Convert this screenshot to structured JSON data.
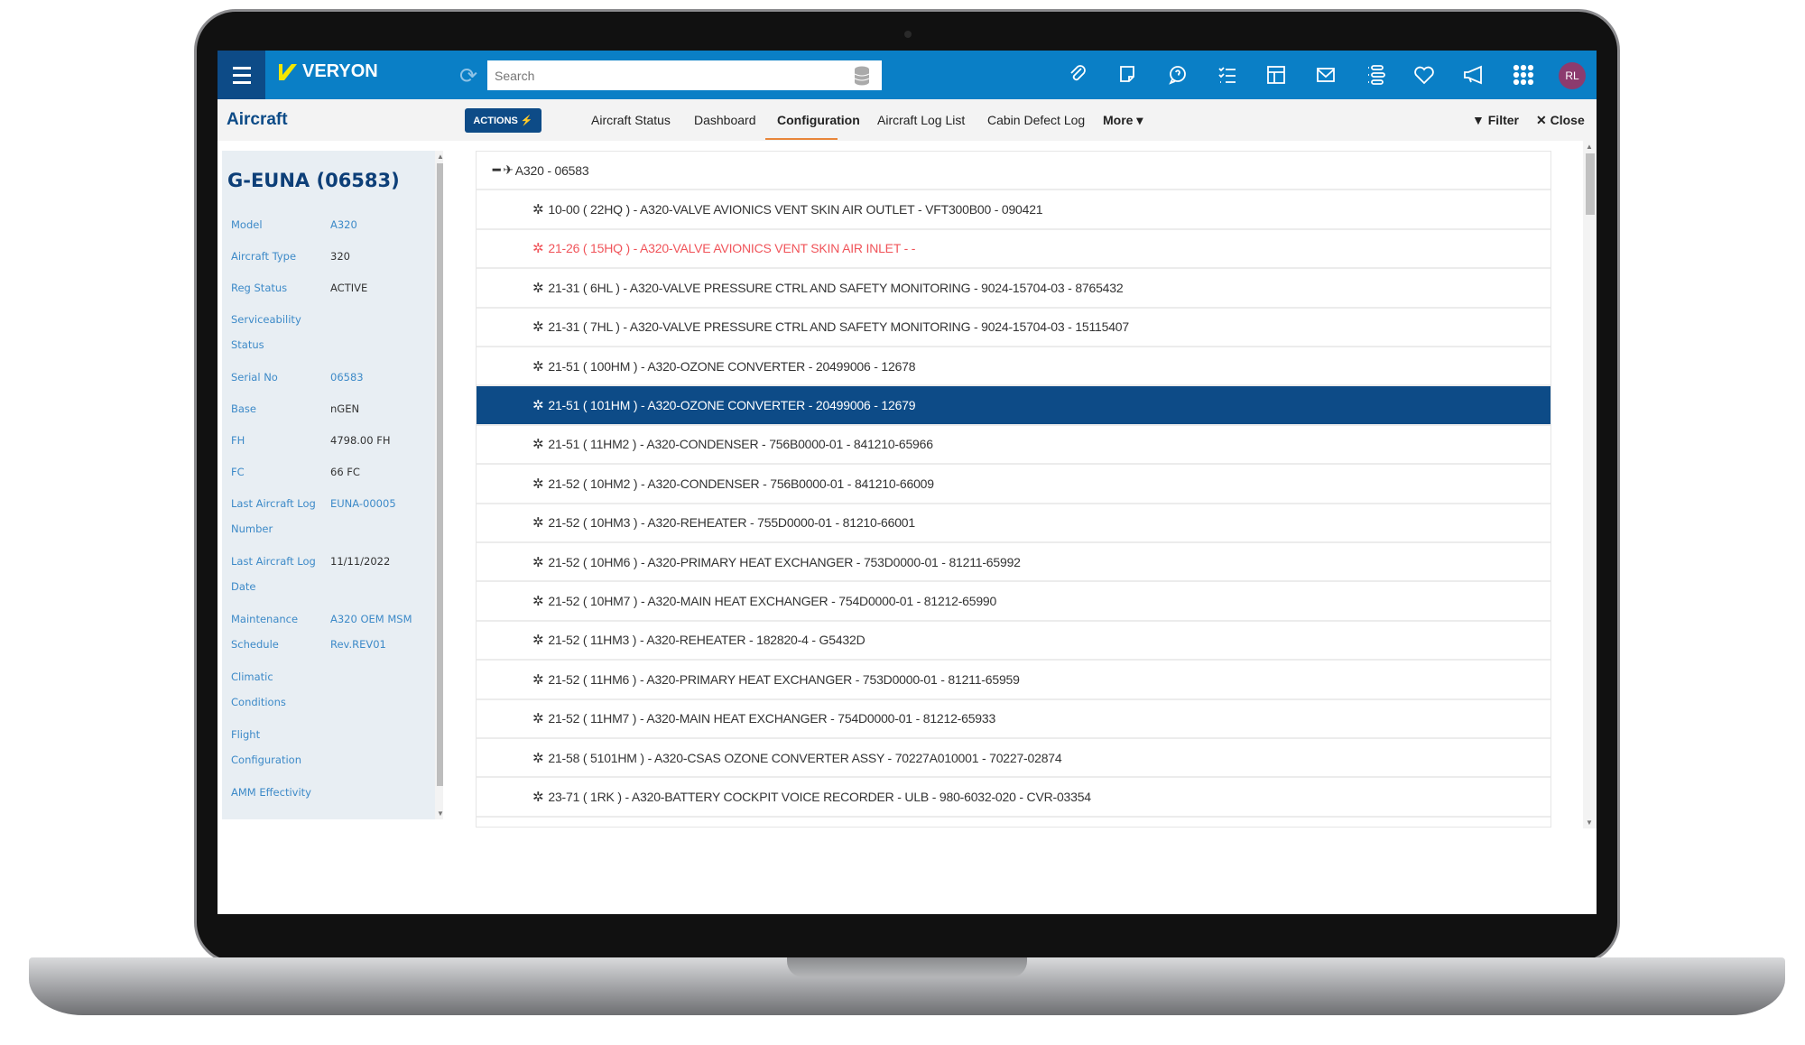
{
  "app": {
    "logo": "VERYON",
    "search_placeholder": "Search",
    "avatar_initials": "RL",
    "brand_color": "#0a7fc6",
    "accent_color": "#e8863a"
  },
  "toolbar_icons": [
    "paperclip-icon",
    "note-icon",
    "help-chat-icon",
    "checklist-icon",
    "layout-icon",
    "mail-icon",
    "list-icon",
    "heart-icon",
    "megaphone-icon",
    "apps-grid-icon"
  ],
  "subheader": {
    "title": "Aircraft",
    "actions_label": "ACTIONS ⚡",
    "tabs": [
      {
        "label": "Aircraft Status"
      },
      {
        "label": "Dashboard"
      },
      {
        "label": "Configuration",
        "active": true
      },
      {
        "label": "Aircraft Log List"
      },
      {
        "label": "Cabin Defect Log"
      },
      {
        "label": "More ▾"
      }
    ],
    "filter_label": "Filter",
    "close_label": "Close"
  },
  "sidebar": {
    "title": "G-EUNA (06583)",
    "fields": [
      {
        "label": "Model",
        "value": "A320",
        "link": true
      },
      {
        "label": "Aircraft Type",
        "value": "320"
      },
      {
        "label": "Reg Status",
        "value": "ACTIVE"
      },
      {
        "label": "Serviceability Status",
        "value": ""
      },
      {
        "label": "Serial No",
        "value": "06583",
        "link": true
      },
      {
        "label": "Base",
        "value": "nGEN"
      },
      {
        "label": "FH",
        "value": "4798.00 FH"
      },
      {
        "label": "FC",
        "value": "66 FC"
      },
      {
        "label": "Last Aircraft Log Number",
        "value": "EUNA-00005",
        "link": true
      },
      {
        "label": "Last Aircraft Log Date",
        "value": "11/11/2022"
      },
      {
        "label": "Maintenance Schedule",
        "value": "A320 OEM MSM Rev.REV01",
        "link": true
      },
      {
        "label": "Climatic Conditions",
        "value": ""
      },
      {
        "label": "Flight Configuration",
        "value": ""
      },
      {
        "label": "AMM Effectivity",
        "value": ""
      }
    ]
  },
  "tree": {
    "root": "A320 - 06583",
    "items": [
      {
        "text": "10-00 ( 22HQ ) - A320-VALVE AVIONICS VENT SKIN AIR OUTLET - VFT300B00 - 090421"
      },
      {
        "text": "21-26 ( 15HQ ) - A320-VALVE AVIONICS VENT SKIN AIR INLET - -",
        "status": "error"
      },
      {
        "text": "21-31 ( 6HL ) - A320-VALVE PRESSURE CTRL AND SAFETY MONITORING - 9024-15704-03 - 8765432"
      },
      {
        "text": "21-31 ( 7HL ) - A320-VALVE PRESSURE CTRL AND SAFETY MONITORING - 9024-15704-03 - 15115407"
      },
      {
        "text": "21-51 ( 100HM ) - A320-OZONE CONVERTER - 20499006 - 12678"
      },
      {
        "text": "21-51 ( 101HM ) - A320-OZONE CONVERTER - 20499006 - 12679",
        "selected": true
      },
      {
        "text": "21-51 ( 11HM2 ) - A320-CONDENSER - 756B0000-01 - 841210-65966"
      },
      {
        "text": "21-52 ( 10HM2 ) - A320-CONDENSER - 756B0000-01 - 841210-66009"
      },
      {
        "text": "21-52 ( 10HM3 ) - A320-REHEATER - 755D0000-01 - 81210-66001"
      },
      {
        "text": "21-52 ( 10HM6 ) - A320-PRIMARY HEAT EXCHANGER - 753D0000-01 - 81211-65992"
      },
      {
        "text": "21-52 ( 10HM7 ) - A320-MAIN HEAT EXCHANGER - 754D0000-01 - 81212-65990"
      },
      {
        "text": "21-52 ( 11HM3 ) - A320-REHEATER - 182820-4 - G5432D"
      },
      {
        "text": "21-52 ( 11HM6 ) - A320-PRIMARY HEAT EXCHANGER - 753D0000-01 - 81211-65959"
      },
      {
        "text": "21-52 ( 11HM7 ) - A320-MAIN HEAT EXCHANGER - 754D0000-01 - 81212-65933"
      },
      {
        "text": "21-58 ( 5101HM ) - A320-CSAS OZONE CONVERTER ASSY - 70227A010001 - 70227-02874"
      },
      {
        "text": "23-71 ( 1RK ) - A320-BATTERY COCKPIT VOICE RECORDER - ULB - 980-6032-020 - CVR-03354"
      }
    ]
  }
}
